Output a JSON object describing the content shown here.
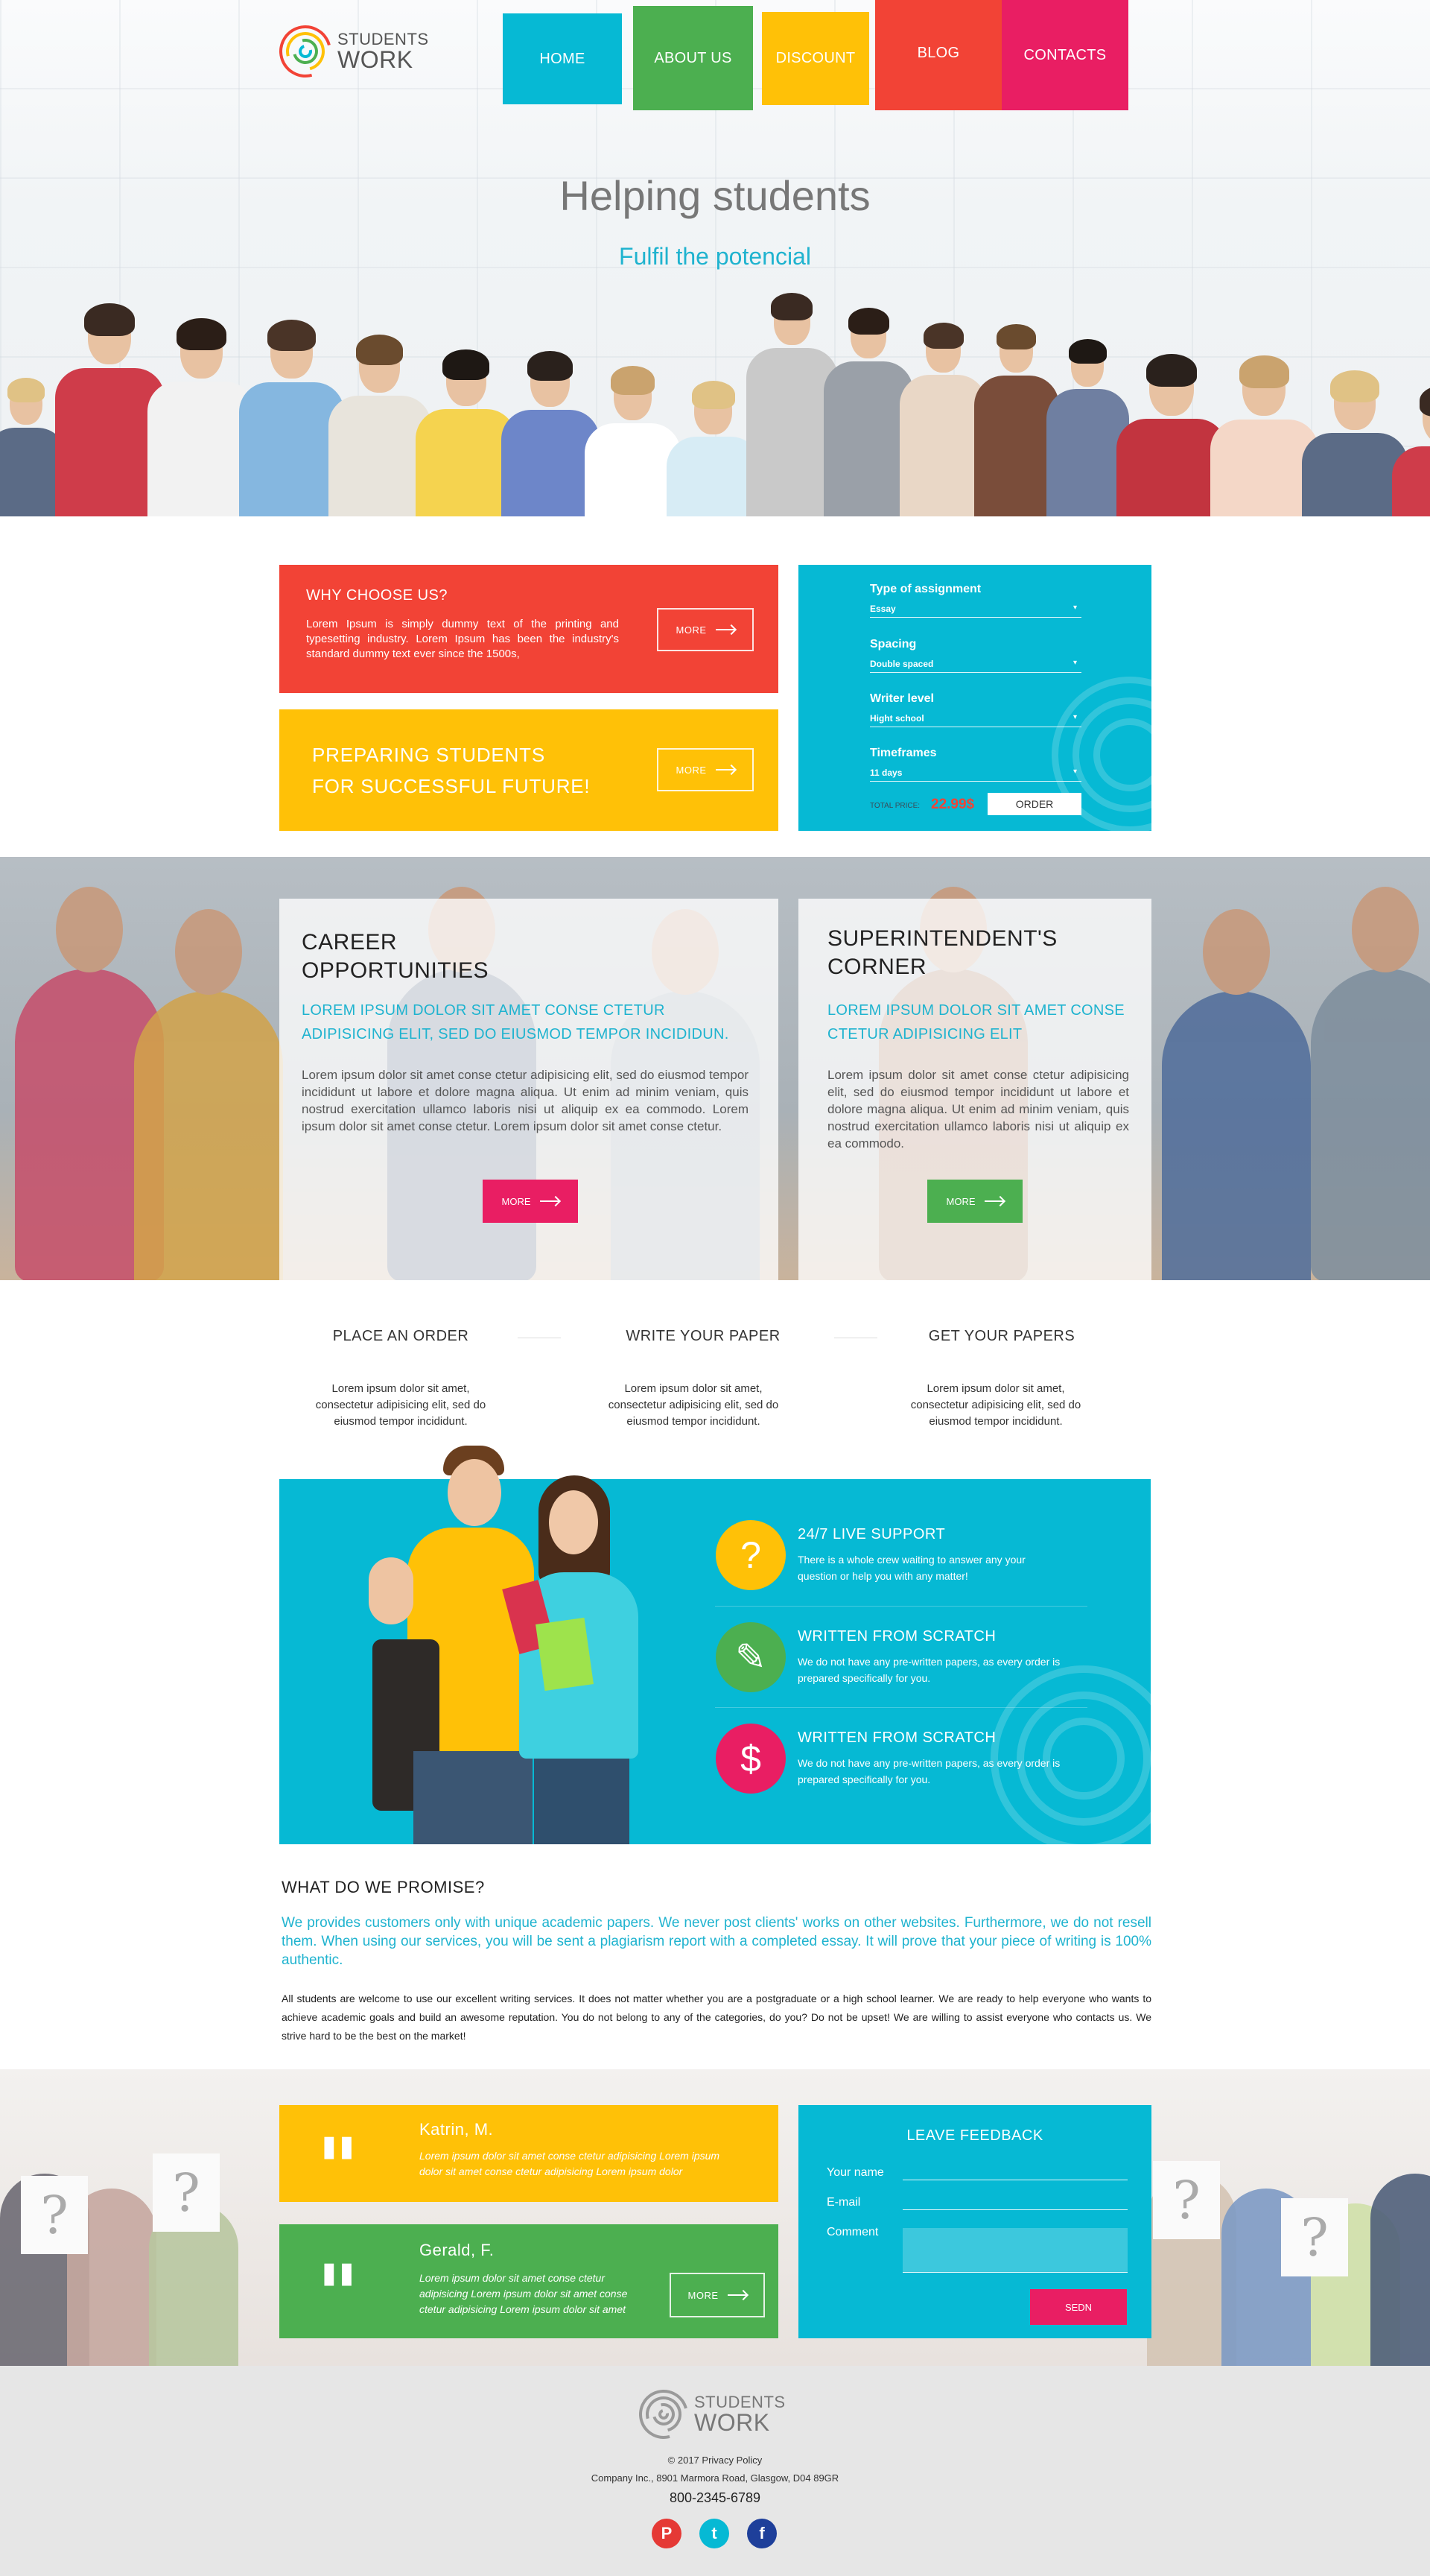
{
  "brand": {
    "line1": "STUDENTS",
    "line2": "WORK"
  },
  "nav": [
    {
      "label": "HOME",
      "color": "#06b9d4"
    },
    {
      "label": "ABOUT US",
      "color": "#4caf50"
    },
    {
      "label": "DISCOUNT",
      "color": "#ffc107"
    },
    {
      "label": "BLOG",
      "color": "#f24336"
    },
    {
      "label": "CONTACTS",
      "color": "#e91e63"
    }
  ],
  "hero": {
    "title": "Helping students",
    "subtitle": "Fulfil the potencial"
  },
  "why": {
    "title": "WHY CHOOSE US?",
    "text": "Lorem Ipsum is simply dummy text of the printing and typesetting industry. Lorem Ipsum has been the industry's standard dummy text ever since the 1500s,",
    "more": "MORE"
  },
  "preparing": {
    "line1": "PREPARING STUDENTS",
    "line2": "FOR SUCCESSFUL FUTURE!",
    "more": "MORE"
  },
  "calculator": {
    "fields": [
      {
        "label": "Type of assignment",
        "value": "Essay"
      },
      {
        "label": "Spacing",
        "value": "Double spaced"
      },
      {
        "label": "Writer level",
        "value": "Hight school"
      },
      {
        "label": "Timeframes",
        "value": "11 days"
      }
    ],
    "total_label": "TOTAL PRICE:",
    "total_value": "22.99$",
    "order": "ORDER"
  },
  "career": {
    "title_line1": "CAREER",
    "title_line2": "OPPORTUNITIES",
    "lead": "LOREM IPSUM DOLOR SIT AMET CONSE CTETUR ADIPISICING ELIT, SED DO EIUSMOD TEMPOR INCIDIDUN.",
    "body": "Lorem ipsum dolor sit amet conse ctetur adipisicing elit, sed do eiusmod tempor incididunt ut labore et dolore magna aliqua. Ut enim ad minim veniam, quis nostrud exercitation ullamco laboris nisi ut aliquip ex ea commodo. Lorem ipsum dolor sit amet conse ctetur. Lorem ipsum dolor sit amet conse ctetur.",
    "more": "MORE"
  },
  "superintendent": {
    "title_line1": "SUPERINTENDENT'S",
    "title_line2": "CORNER",
    "lead": "LOREM IPSUM DOLOR SIT AMET CONSE CTETUR ADIPISICING ELIT",
    "body": "Lorem ipsum dolor sit amet conse ctetur adipisicing elit, sed do eiusmod tempor incididunt ut labore et dolore magna aliqua. Ut enim ad minim veniam, quis nostrud exercitation ullamco laboris nisi ut aliquip ex ea commodo.",
    "more": "MORE"
  },
  "steps": [
    {
      "title": "PLACE AN ORDER",
      "text": "Lorem ipsum dolor sit amet, consectetur adipisicing elit, sed do eiusmod tempor incididunt."
    },
    {
      "title": "WRITE YOUR PAPER",
      "text": "Lorem ipsum dolor sit amet, consectetur adipisicing elit, sed do eiusmod tempor incididunt."
    },
    {
      "title": "GET YOUR PAPERS",
      "text": "Lorem ipsum dolor sit amet, consectetur adipisicing elit, sed do eiusmod tempor incididunt."
    }
  ],
  "features": [
    {
      "icon": "question-icon",
      "glyph": "?",
      "color": "#ffc107",
      "title": "24/7 LIVE SUPPORT",
      "text": "There is a whole crew waiting to answer any your question or help you with any matter!"
    },
    {
      "icon": "pencil-icon",
      "glyph": "✎",
      "color": "#4caf50",
      "title": "WRITTEN FROM SCRATCH",
      "text": "We do not have any pre-written papers, as every order is prepared specifically for you."
    },
    {
      "icon": "dollar-icon",
      "glyph": "$",
      "color": "#e91e63",
      "title": "WRITTEN FROM SCRATCH",
      "text": "We do not have any pre-written papers, as every order is prepared specifically for you."
    }
  ],
  "promise": {
    "title": "WHAT DO WE PROMISE?",
    "lead": "We provides customers only with unique academic papers. We never post clients' works on other websites. Furthermore, we do not resell them. When using our services, you will be sent a plagiarism report with a completed essay. It will prove that your piece of writing is 100% authentic.",
    "body": "All students are welcome to use our excellent writing services. It does not matter whether you are a postgraduate or a high school learner. We are ready to help everyone who wants to achieve academic goals and build an awesome reputation. You do not belong to any of the categories, do you? Do not be upset! We are willing to assist everyone who contacts us. We strive hard to be the best on the market!"
  },
  "testimonials": [
    {
      "name": "Katrin, M.",
      "text": "Lorem ipsum dolor sit amet conse ctetur adipisicing Lorem ipsum dolor sit amet conse ctetur adipisicing Lorem ipsum dolor",
      "color": "#ffc107"
    },
    {
      "name": "Gerald, F.",
      "text": "Lorem ipsum dolor sit amet conse ctetur adipisicing Lorem ipsum dolor sit amet conse ctetur adipisicing Lorem ipsum dolor sit amet",
      "color": "#4caf50",
      "more": "MORE"
    }
  ],
  "feedback": {
    "title": "LEAVE FEEDBACK",
    "name_label": "Your name",
    "email_label": "E-mail",
    "comment_label": "Comment",
    "send": "SEDN"
  },
  "footer": {
    "copyright": "© 2017 Privacy Policy",
    "address": "Company Inc., 8901 Marmora Road, Glasgow, D04 89GR",
    "phone": "800-2345-6789",
    "social": [
      {
        "icon": "pinterest-icon",
        "glyph": "P",
        "color": "#e53935"
      },
      {
        "icon": "twitter-icon",
        "glyph": "t",
        "color": "#06b9d4"
      },
      {
        "icon": "facebook-icon",
        "glyph": "f",
        "color": "#1e3f9a"
      }
    ]
  }
}
